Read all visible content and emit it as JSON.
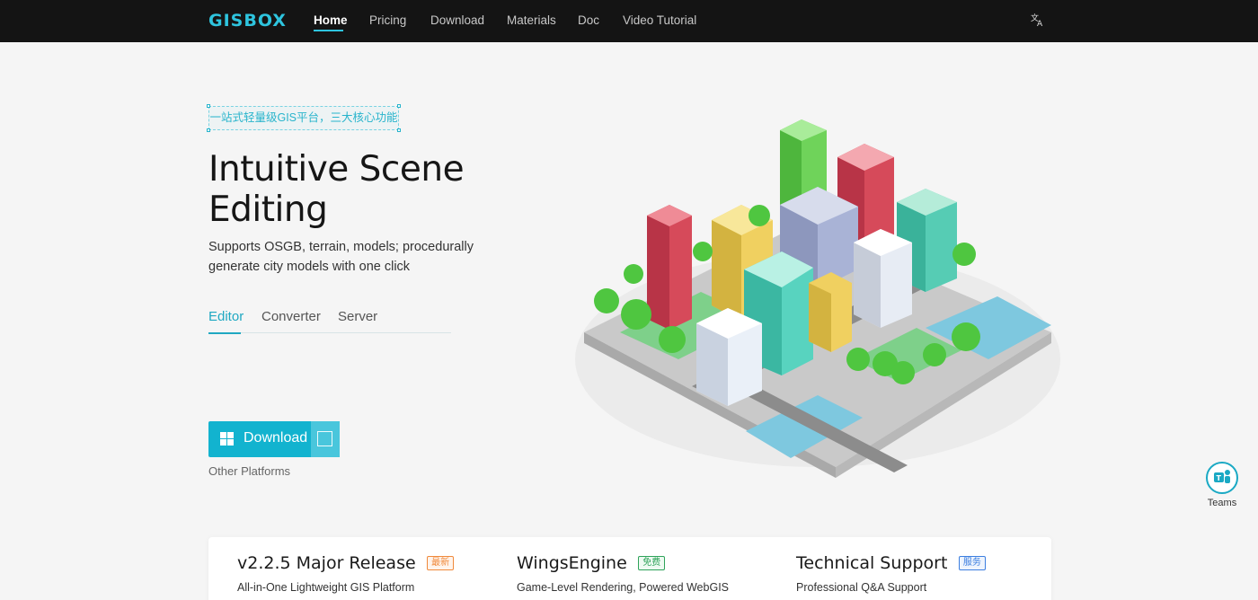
{
  "nav": {
    "logo": "GISBOX",
    "items": [
      {
        "label": "Home",
        "active": true
      },
      {
        "label": "Pricing"
      },
      {
        "label": "Download"
      },
      {
        "label": "Materials"
      },
      {
        "label": "Doc"
      },
      {
        "label": "Video Tutorial"
      }
    ],
    "language_icon": "translate-icon"
  },
  "hero": {
    "tag": "一站式轻量级GIS平台，三大核心功能",
    "headline": "Intuitive Scene Editing",
    "subline": "Supports OSGB, terrain, models; procedurally generate city models with one click",
    "tabs": [
      {
        "label": "Editor",
        "active": true
      },
      {
        "label": "Converter"
      },
      {
        "label": "Server"
      }
    ],
    "download_label": "Download",
    "download_icon": "windows-icon",
    "other_platforms": "Other Platforms"
  },
  "floating": {
    "teams_label": "Teams",
    "teams_icon": "teams-icon"
  },
  "features": [
    {
      "title": "v2.2.5 Major Release",
      "badge": "最新",
      "badge_color": "#f08a3c",
      "desc": "All-in-One Lightweight GIS Platform"
    },
    {
      "title": "WingsEngine",
      "badge": "免费",
      "badge_color": "#2fa35a",
      "desc": "Game-Level Rendering, Powered WebGIS"
    },
    {
      "title": "Technical Support",
      "badge": "服务",
      "badge_color": "#3d7fe0",
      "desc": "Professional Q&A Support"
    }
  ],
  "colors": {
    "accent": "#12b3cf",
    "nav_bg": "#141414",
    "page_bg": "#f5f5f5"
  }
}
